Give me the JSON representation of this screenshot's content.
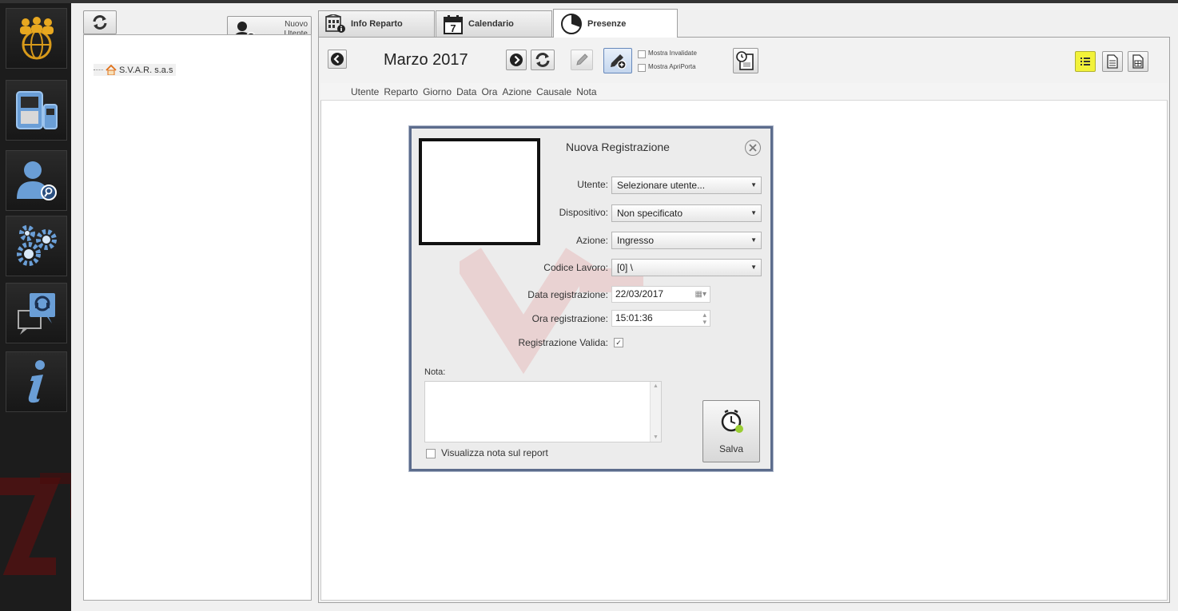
{
  "tree": {
    "new_user_label_line1": "Nuovo",
    "new_user_label_line2": "Utente",
    "root_item": "S.V.A.R. s.a.s"
  },
  "tabs": [
    {
      "label": "Info Reparto",
      "icon": "building-info-icon"
    },
    {
      "label": "Calendario",
      "icon": "calendar-icon"
    },
    {
      "label": "Presenze",
      "icon": "clock-pie-icon"
    }
  ],
  "calendar_day": "7",
  "toolbar": {
    "month_label": "Marzo 2017",
    "show_invalid_label": "Mostra Invalidate",
    "show_apriporta_label": "Mostra ApriPorta"
  },
  "grid": {
    "columns": [
      "Utente",
      "Reparto",
      "Giorno",
      "Data",
      "Ora",
      "Azione",
      "Causale",
      "Nota"
    ]
  },
  "dialog": {
    "title": "Nuova Registrazione",
    "utente_label": "Utente:",
    "utente_value": "Selezionare utente...",
    "dispositivo_label": "Dispositivo:",
    "dispositivo_value": "Non specificato",
    "azione_label": "Azione:",
    "azione_value": "Ingresso",
    "codice_label": "Codice Lavoro:",
    "codice_value": "[0] \\",
    "data_label": "Data registrazione:",
    "data_value": "22/03/2017",
    "ora_label": "Ora registrazione:",
    "ora_value": "15:01:36",
    "valida_label": "Registrazione Valida:",
    "valida_checked": true,
    "nota_label": "Nota:",
    "nota_value": "",
    "visualizza_label": "Visualizza nota sul report",
    "save_label": "Salva"
  },
  "colors": {
    "sidebar_bg": "#1c1c1c",
    "accent_yellow": "#f2f23a",
    "dialog_border": "#5c6c8c",
    "icon_gold": "#e0a020",
    "icon_blue": "#5a8fc8"
  }
}
